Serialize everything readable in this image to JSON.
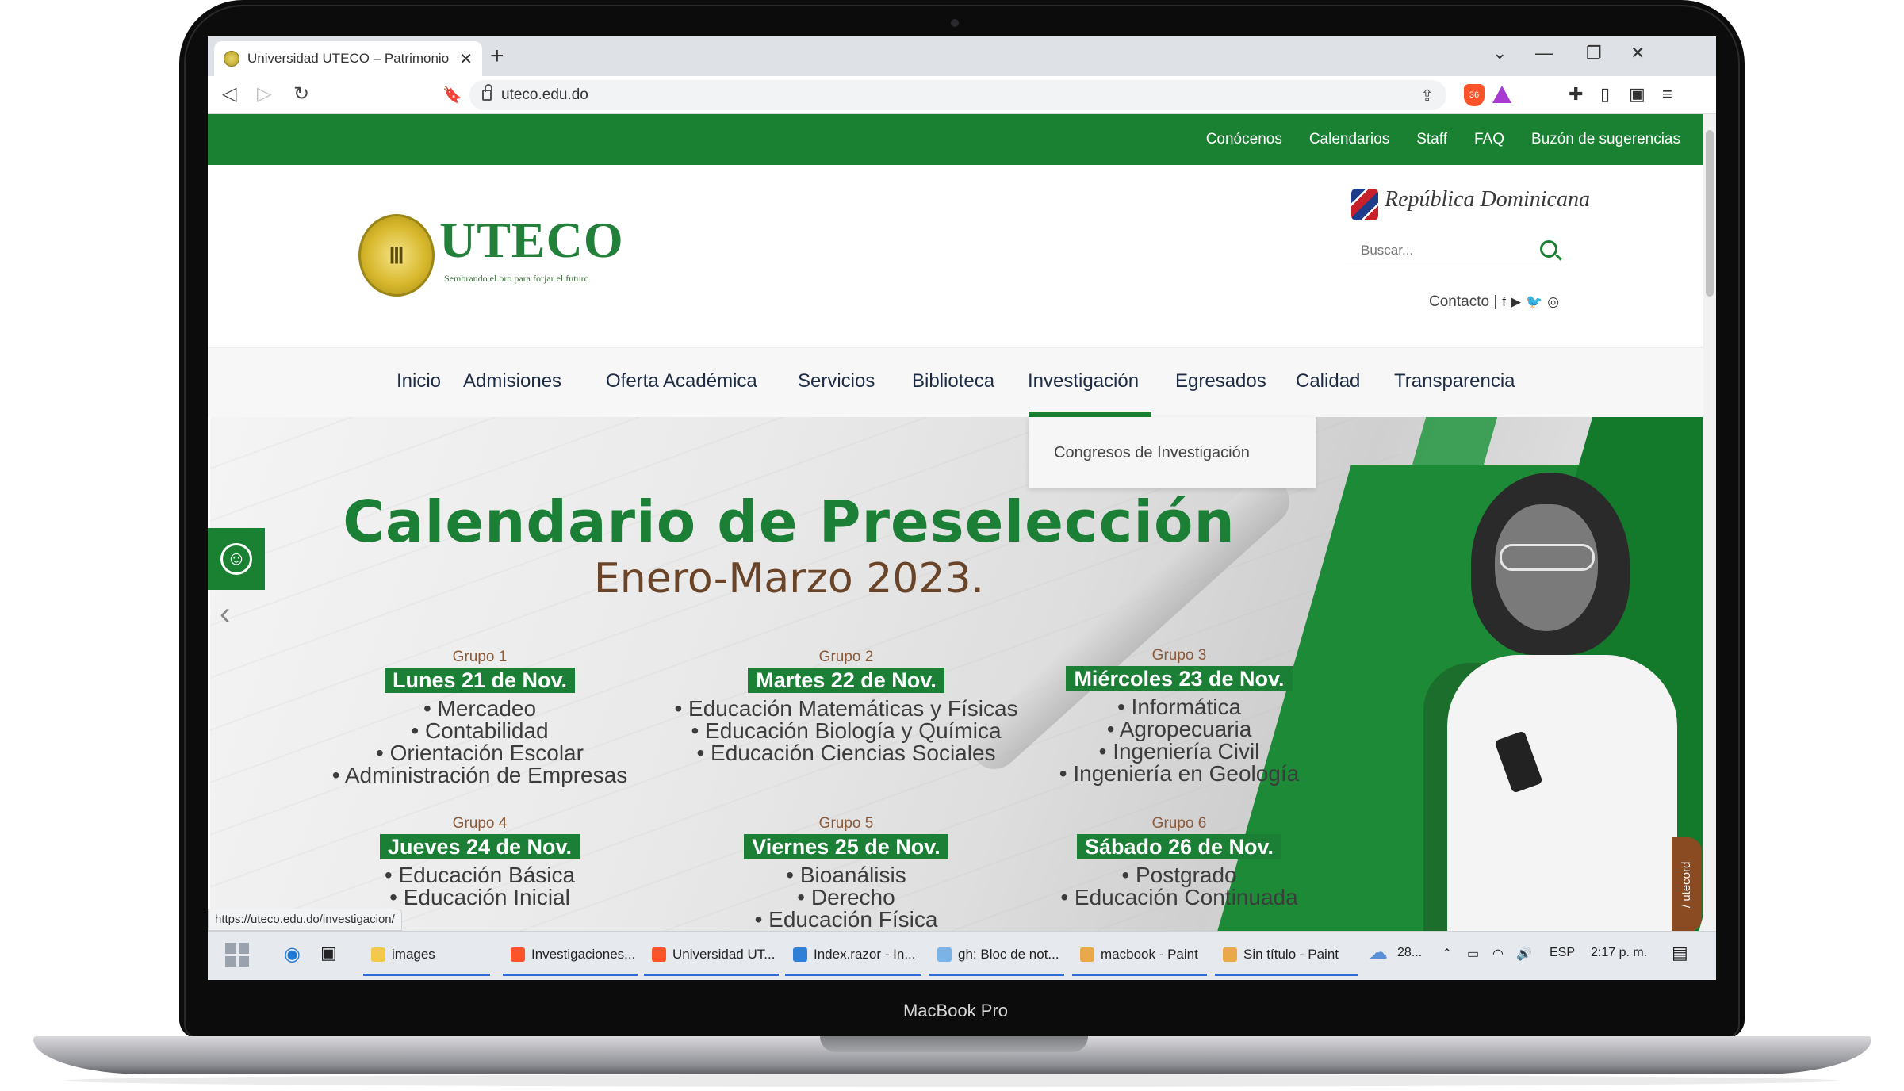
{
  "device": {
    "label": "MacBook Pro"
  },
  "browser": {
    "tab_title": "Universidad UTECO – Patrimonio",
    "url": "uteco.edu.do",
    "status_url": "https://uteco.edu.do/investigacion/"
  },
  "site": {
    "topbar_links": [
      "Conócenos",
      "Calendarios",
      "Staff",
      "FAQ",
      "Buzón de sugerencias"
    ],
    "logo_name": "UTECO",
    "logo_tagline": "Sembrando el oro para forjar el futuro",
    "republica": "República Dominicana",
    "search_placeholder": "Buscar...",
    "contacto": "Contacto |",
    "nav": [
      "Inicio",
      "Admisiones",
      "Oferta Académica",
      "Servicios",
      "Biblioteca",
      "Investigación",
      "Egresados",
      "Calidad",
      "Transparencia"
    ],
    "active_nav": "Investigación",
    "dropdown_item": "Congresos de Investigación"
  },
  "hero": {
    "title": "Calendario de Preselección",
    "subtitle": "Enero-Marzo 2023.",
    "side_tag": "/ utecord",
    "groups": [
      {
        "label": "Grupo 1",
        "day": "Lunes 21 de Nov.",
        "items": [
          "• Mercadeo",
          "• Contabilidad",
          "• Orientación Escolar",
          "• Administración de Empresas"
        ]
      },
      {
        "label": "Grupo 2",
        "day": "Martes 22 de Nov.",
        "items": [
          "• Educación Matemáticas y Físicas",
          "• Educación Biología y Química",
          "• Educación Ciencias Sociales"
        ]
      },
      {
        "label": "Grupo 3",
        "day": "Miércoles 23 de Nov.",
        "items": [
          "• Informática",
          "• Agropecuaria",
          "• Ingeniería Civil",
          "• Ingeniería en Geología"
        ]
      },
      {
        "label": "Grupo 4",
        "day": "Jueves 24 de Nov.",
        "items": [
          "• Educación Básica",
          "• Educación Inicial"
        ]
      },
      {
        "label": "Grupo 5",
        "day": "Viernes 25 de Nov.",
        "items": [
          "• Bioanálisis",
          "• Derecho",
          "• Educación Física"
        ]
      },
      {
        "label": "Grupo 6",
        "day": "Sábado 26 de Nov.",
        "items": [
          "• Postgrado",
          "• Educación Continuada"
        ]
      }
    ]
  },
  "taskbar": {
    "apps": [
      {
        "label": "images",
        "color": "#f2c94c"
      },
      {
        "label": "Investigaciones...",
        "color": "#fb542b"
      },
      {
        "label": "Universidad UT...",
        "color": "#fb542b"
      },
      {
        "label": "Index.razor - In...",
        "color": "#2f7fd6"
      },
      {
        "label": "gh: Bloc de not...",
        "color": "#7bb3e6"
      },
      {
        "label": "macbook - Paint",
        "color": "#e9a94a"
      },
      {
        "label": "Sin título - Paint",
        "color": "#e9a94a"
      }
    ],
    "weather": "28...",
    "lang": "ESP",
    "time": "2:17 p. m."
  },
  "colors": {
    "brand_green": "#1a8132",
    "accent_brown": "#6a4428"
  }
}
